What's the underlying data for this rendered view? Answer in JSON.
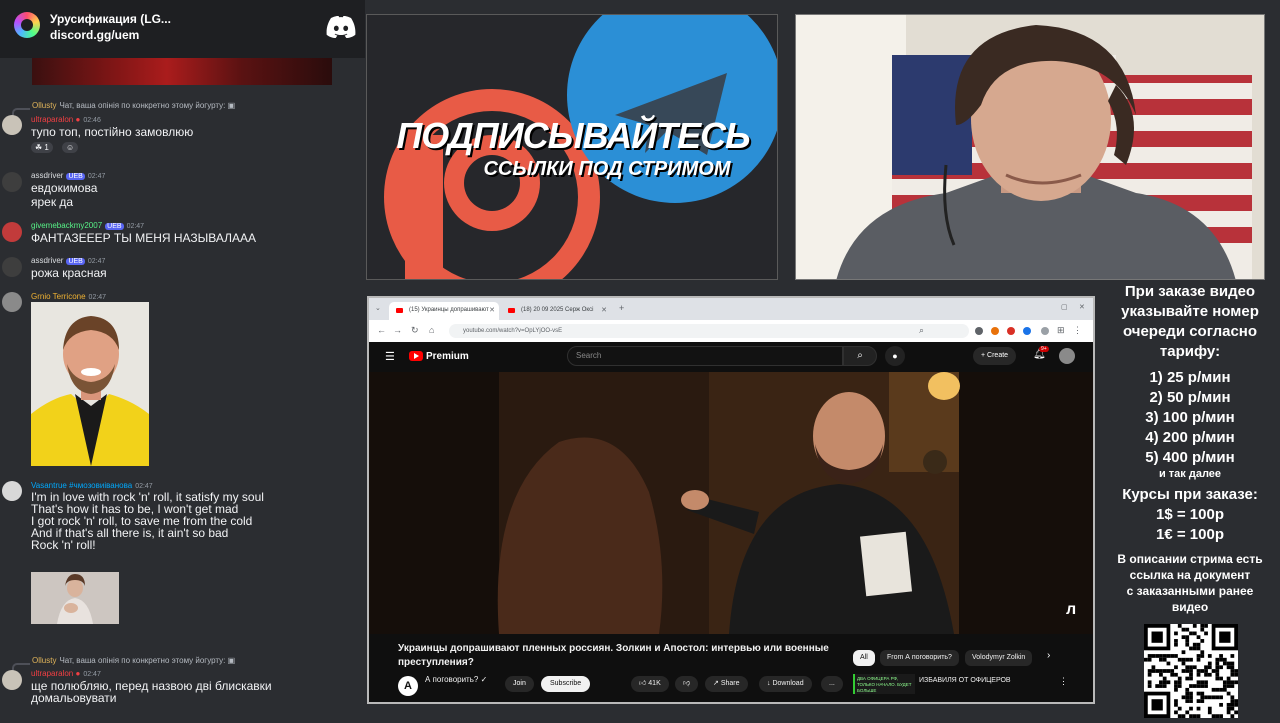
{
  "chat": {
    "server_name": "Урусификация (LG...",
    "invite": "discord.gg/uem",
    "messages": [
      {
        "reply_user": "Ollusty",
        "reply_text": "Чат, ваша опінія по конкретно этому йогурту:",
        "user": "ultraparalon",
        "time": "02:46",
        "text": "тупо топ, постійно замовлюю",
        "reaction_count": "1"
      },
      {
        "user": "assdriver",
        "badge": "UEB",
        "time": "02:47",
        "lines": [
          "евдокимова",
          "ярек да"
        ]
      },
      {
        "user": "givemebackmy2007",
        "badge": "UEB",
        "time": "02:47",
        "text": "ФАНТАЗЕЕЕР ТЫ МЕНЯ НАЗЫВАЛААА"
      },
      {
        "user": "assdriver",
        "badge": "UEB",
        "time": "02:47",
        "text": "рожа красная"
      },
      {
        "user": "Grnio Terricone",
        "time": "02:47"
      },
      {
        "user": "Vasantrue #чмозовиіванова",
        "time": "02:47",
        "lines": [
          "I'm in love with rock 'n' roll, it satisfy my soul",
          "That's how it has to be, I won't get mad",
          "I got rock 'n' roll, to save me from the cold",
          "And if that's all there is, it ain't so bad",
          "Rock 'n' roll!"
        ]
      },
      {
        "reply_user": "Ollusty",
        "reply_text": "Чат, ваша опінія по конкретно этому йогурту:",
        "user": "ultraparalon",
        "time": "02:47",
        "lines": [
          "ще полюбляю, перед назвою дві блискавки",
          "домальовувати"
        ]
      }
    ]
  },
  "promo": {
    "title": "ПОДПИСЫВАЙТЕСЬ",
    "subtitle": "ССЫЛКИ ПОД СТРИМОМ",
    "colors": {
      "patreon": "#e85b46",
      "telegram": "#2b8fd6"
    }
  },
  "browser": {
    "tabs": [
      {
        "label": "(15) Украинцы допрашивают",
        "active": true
      },
      {
        "label": "(18) 20 09 2025 Серж Оксi",
        "active": false
      }
    ],
    "url": "youtube.com/watch?v=OpLYjOO-vsE"
  },
  "youtube": {
    "brand": "Premium",
    "search_placeholder": "Search",
    "create_label": "Create",
    "notification_count": "9+",
    "video_title": "Украинцы допрашивают пленных россиян. Золкин и Апостол: интервью или военные преступления?",
    "channel_name": "А поговорить?",
    "channel_initial": "А",
    "join_label": "Join",
    "subscribe_label": "Subscribe",
    "likes": "41K",
    "share_label": "Share",
    "download_label": "Download",
    "more_label": "...",
    "chips": [
      "All",
      "From А поговорить?",
      "Volodymyr Zolkin"
    ],
    "recommended_thumb_text": "ДВА ОФИЦЕРА РФ, ТОЛЬКО НАЧАЛО. БУДЕТ БОЛЬШЕ",
    "recommended_title": "ИЗБАВИЛЯ ОТ ОФИЦЕРОВ"
  },
  "info_panel": {
    "order_text": [
      "При заказе видео",
      "указывайте номер",
      "очереди согласно",
      "тарифу:"
    ],
    "tariffs": [
      "1) 25 р/мин",
      "2) 50 р/мин",
      "3) 100 р/мин",
      "4) 200 р/мин",
      "5) 400 р/мин"
    ],
    "tariffs_more": "и так далее",
    "rates_title": "Курсы при заказе:",
    "rates": [
      "1$ = 100р",
      "1€ = 100р"
    ],
    "description_text": [
      "В описании стрима есть",
      "ссылка на документ",
      "с заказанными ранее",
      "видео"
    ]
  }
}
